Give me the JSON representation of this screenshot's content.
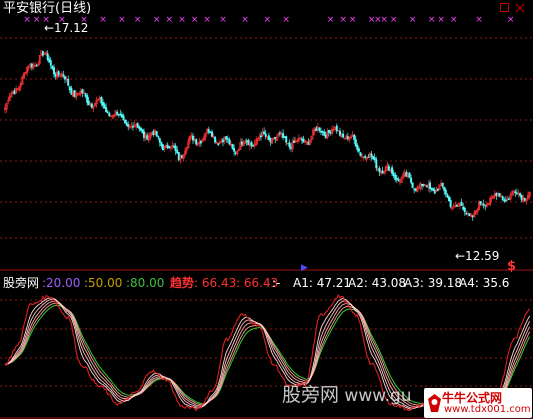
{
  "chart_data": [
    {
      "type": "candlestick",
      "title": "平安银行(日线)",
      "annotations": [
        {
          "label": "17.12",
          "bar": 23
        },
        {
          "label": "12.59",
          "bar": 297
        }
      ],
      "ylim": [
        11.3,
        18.2
      ],
      "colors": {
        "up": "#ff3232",
        "down": "#54fcfc",
        "grid": "#8b1a1a",
        "signal": "#ff40ff"
      },
      "signal_marker": "×",
      "bottom_markers": [
        {
          "symbol": "▶",
          "color": "#4a4aff"
        },
        {
          "symbol": "$",
          "color": "#ff3333"
        }
      ],
      "candles": []
    },
    {
      "type": "line",
      "title": "股旁网",
      "levels": [
        {
          "label": "20.00",
          "color": "#a05cff"
        },
        {
          "label": "50.00",
          "color": "#c8a000"
        },
        {
          "label": "80.00",
          "color": "#40c040"
        }
      ],
      "indicators": [
        {
          "label": "趋势",
          "value": "66.43",
          "color": "#ff3030"
        },
        {
          "label": "",
          "value": "66.43",
          "color": "#ff3030"
        },
        {
          "label": "A1",
          "value": "47.21",
          "color": "#ffffff"
        },
        {
          "label": "A2",
          "value": "43.08",
          "color": "#ffffff"
        },
        {
          "label": "A3",
          "value": "39.18",
          "color": "#ffffff"
        },
        {
          "label": "A4",
          "value": "35.6",
          "color": "#ffffff"
        }
      ],
      "series": []
    }
  ],
  "top_window": {
    "title": "平安银行(日线)",
    "annotation_high": "←17.12",
    "annotation_low": "←12.59",
    "signal_dollar": "$"
  },
  "bottom_window": {
    "name": "股旁网",
    "lvl20": "20.00",
    "lvl50": "50.00",
    "lvl80": "80.00",
    "trend_label": "趋势",
    "trend_value": "66.43",
    "trend_value2": "66.43",
    "sep": ":-",
    "a1": "A1: 47.21",
    "a2": "A2: 43.08",
    "a3": "A3: 39.18",
    "a4": "A4: 35.6"
  },
  "watermark": "股旁网",
  "site": {
    "name": "牛牛公式网",
    "url": "www.tdx001.com"
  }
}
